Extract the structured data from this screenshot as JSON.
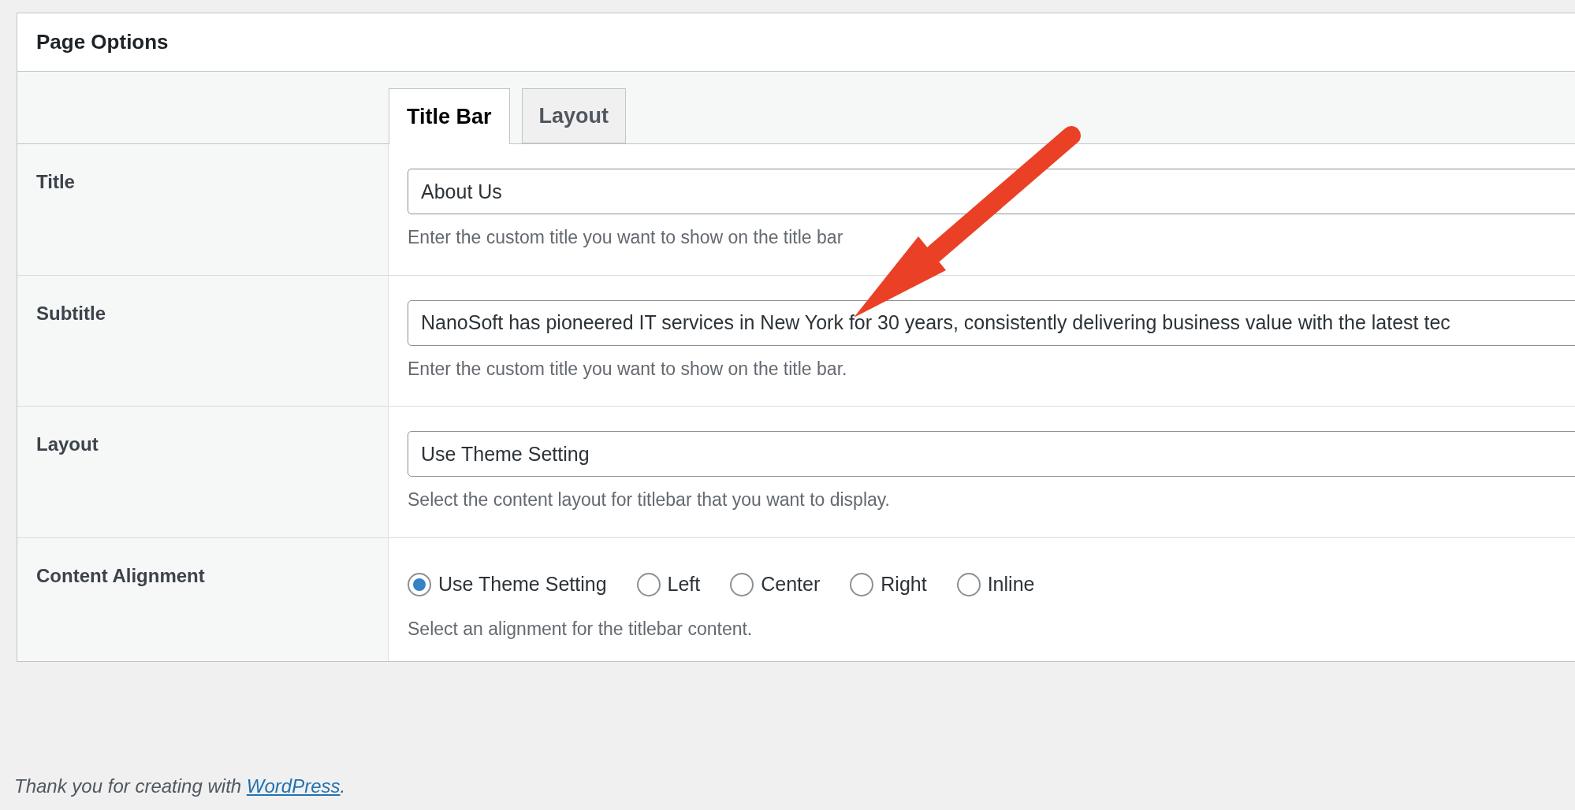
{
  "panel": {
    "title": "Page Options"
  },
  "tabs": [
    {
      "label": "Title Bar",
      "selected": true
    },
    {
      "label": "Layout",
      "selected": false
    }
  ],
  "rows": [
    {
      "kind": "text",
      "label": "Title",
      "value": "About Us",
      "description": "Enter the custom title you want to show on the title bar"
    },
    {
      "kind": "text",
      "label": "Subtitle",
      "value": "NanoSoft has pioneered IT services in New York for 30 years, consistently delivering business value with the latest tec",
      "description": "Enter the custom title you want to show on the title bar."
    },
    {
      "kind": "select",
      "label": "Layout",
      "value": "Use Theme Setting",
      "description": "Select the content layout for titlebar that you want to display."
    },
    {
      "kind": "radio",
      "label": "Content Alignment",
      "options": [
        {
          "label": "Use Theme Setting",
          "selected": true
        },
        {
          "label": "Left",
          "selected": false
        },
        {
          "label": "Center",
          "selected": false
        },
        {
          "label": "Right",
          "selected": false
        },
        {
          "label": "Inline",
          "selected": false
        }
      ],
      "description": "Select an alignment for the titlebar content."
    }
  ],
  "footer": {
    "text": "Thank you for creating with ",
    "link": "WordPress",
    "after": "."
  }
}
